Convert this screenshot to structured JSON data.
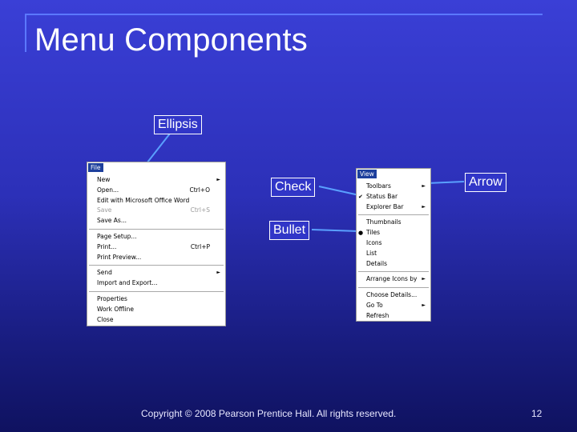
{
  "slide": {
    "title": "Menu Components",
    "footer": "Copyright © 2008 Pearson Prentice Hall. All rights reserved.",
    "page_number": "12"
  },
  "callouts": {
    "ellipsis": "Ellipsis",
    "check": "Check",
    "bullet": "Bullet",
    "arrow": "Arrow"
  },
  "file_menu": {
    "title": "File",
    "items": [
      {
        "label": "New",
        "shortcut": "",
        "arrow": "►",
        "disabled": false
      },
      {
        "label": "Open...",
        "shortcut": "Ctrl+O",
        "arrow": "",
        "disabled": false
      },
      {
        "label": "Edit with Microsoft Office Word",
        "shortcut": "",
        "arrow": "",
        "disabled": false
      },
      {
        "label": "Save",
        "shortcut": "Ctrl+S",
        "arrow": "",
        "disabled": true
      },
      {
        "label": "Save As...",
        "shortcut": "",
        "arrow": "",
        "disabled": false
      },
      {
        "label": "Page Setup...",
        "shortcut": "",
        "arrow": "",
        "disabled": false
      },
      {
        "label": "Print...",
        "shortcut": "Ctrl+P",
        "arrow": "",
        "disabled": false
      },
      {
        "label": "Print Preview...",
        "shortcut": "",
        "arrow": "",
        "disabled": false
      },
      {
        "label": "Send",
        "shortcut": "",
        "arrow": "►",
        "disabled": false
      },
      {
        "label": "Import and Export...",
        "shortcut": "",
        "arrow": "",
        "disabled": false
      },
      {
        "label": "Properties",
        "shortcut": "",
        "arrow": "",
        "disabled": false
      },
      {
        "label": "Work Offline",
        "shortcut": "",
        "arrow": "",
        "disabled": false
      },
      {
        "label": "Close",
        "shortcut": "",
        "arrow": "",
        "disabled": false
      }
    ]
  },
  "view_menu": {
    "title": "View",
    "items": [
      {
        "label": "Toolbars",
        "mark": "",
        "arrow": "►"
      },
      {
        "label": "Status Bar",
        "mark": "✔",
        "arrow": ""
      },
      {
        "label": "Explorer Bar",
        "mark": "",
        "arrow": "►"
      },
      {
        "label": "Thumbnails",
        "mark": "",
        "arrow": ""
      },
      {
        "label": "Tiles",
        "mark": "●",
        "arrow": ""
      },
      {
        "label": "Icons",
        "mark": "",
        "arrow": ""
      },
      {
        "label": "List",
        "mark": "",
        "arrow": ""
      },
      {
        "label": "Details",
        "mark": "",
        "arrow": ""
      },
      {
        "label": "Arrange Icons by",
        "mark": "",
        "arrow": "►"
      },
      {
        "label": "Choose Details...",
        "mark": "",
        "arrow": ""
      },
      {
        "label": "Go To",
        "mark": "",
        "arrow": "►"
      },
      {
        "label": "Refresh",
        "mark": "",
        "arrow": ""
      }
    ]
  }
}
